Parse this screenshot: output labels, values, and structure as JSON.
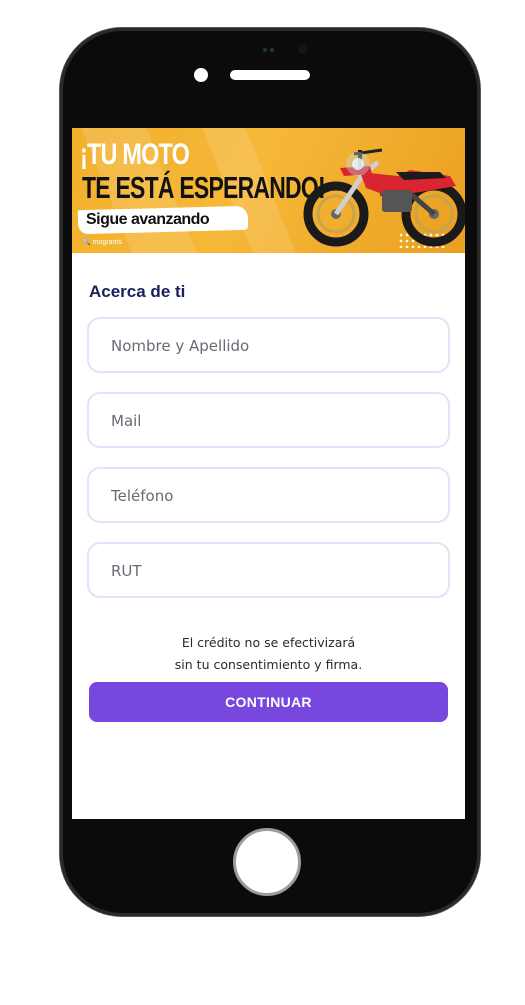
{
  "banner": {
    "line1": "¡TU MOTO",
    "line2": "TE ESTÁ ESPERANDO!",
    "line3": "Sigue avanzando",
    "logo": "mogrants"
  },
  "form": {
    "title": "Acerca de ti",
    "fields": [
      {
        "placeholder": "Nombre y Apellido"
      },
      {
        "placeholder": "Mail"
      },
      {
        "placeholder": "Teléfono"
      },
      {
        "placeholder": "RUT"
      }
    ],
    "disclaimer_line1": "El crédito no se efectivizará",
    "disclaimer_line2": "sin tu consentimiento y firma.",
    "submit_label": "CONTINUAR"
  },
  "colors": {
    "banner_yellow": "#f4b233",
    "title_navy": "#1a1f5e",
    "button_purple": "#7747de",
    "field_border": "#dfe4f6",
    "phone_body": "#0b0b0b"
  },
  "icons": [
    "motorcycle-image",
    "brand-logo-icon",
    "home-button"
  ]
}
